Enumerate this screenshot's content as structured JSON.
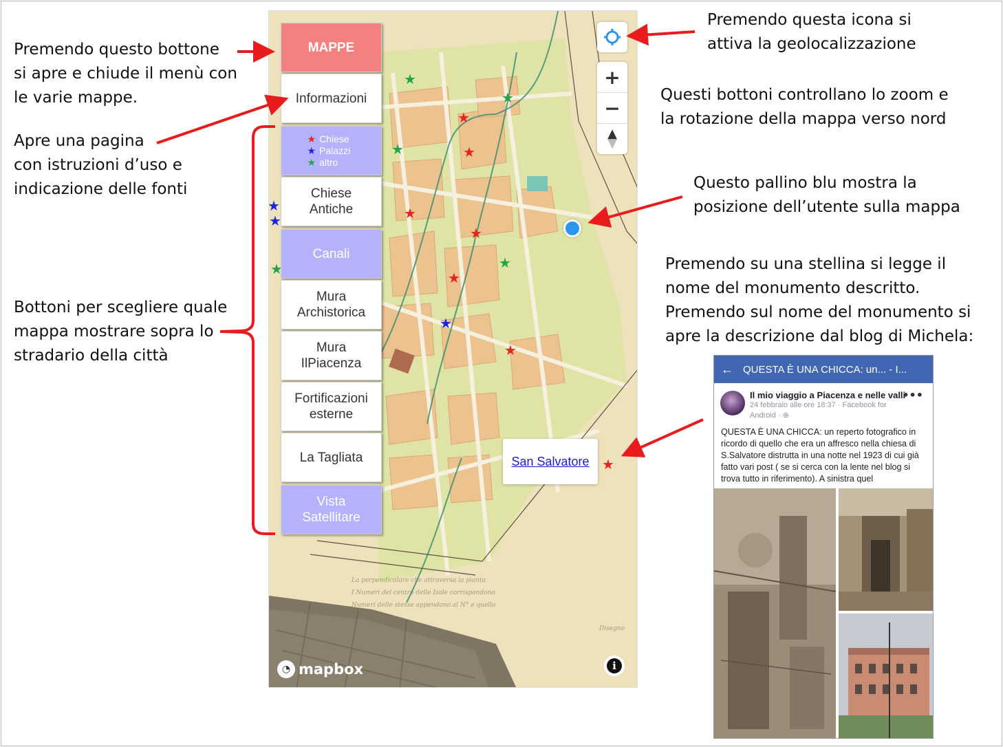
{
  "annotations": {
    "menu_toggle": [
      "Premendo questo bottone",
      "si apre e chiude il menù con",
      "le varie mappe."
    ],
    "info_page": [
      "Apre una pagina",
      "con istruzioni d’uso e",
      "indicazione delle fonti"
    ],
    "map_buttons": [
      "Bottoni per scegliere quale",
      "mappa mostrare sopra lo",
      "stradario della città"
    ],
    "geolocation": [
      "Premendo questa icona si",
      "attiva la geolocalizzazione"
    ],
    "zoom": [
      "Questi bottoni controllano lo zoom e",
      "la rotazione della mappa verso nord"
    ],
    "user_dot": [
      "Questo pallino blu mostra la",
      "posizione dell’utente sulla mappa"
    ],
    "star_click": [
      "Premendo su una stellina si legge il",
      "nome del monumento descritto.",
      "Premendo sul nome del monumento si",
      "apre la descrizione dal blog di Michela:"
    ]
  },
  "menu": {
    "toggle": "MAPPE",
    "informazioni": "Informazioni",
    "legend": [
      {
        "symbol": "★",
        "label": "Chiese",
        "color": "#e8251d"
      },
      {
        "symbol": "★",
        "label": "Palazzi",
        "color": "#1b26e2"
      },
      {
        "symbol": "★",
        "label": "altro",
        "color": "#20a548"
      }
    ],
    "chiese_1": "Chiese",
    "chiese_2": "Antiche",
    "canali": "Canali",
    "mura_a_1": "Mura",
    "mura_a_2": "Archistorica",
    "mura_p_1": "Mura",
    "mura_p_2": "IlPiacenza",
    "fort_1": "Fortificazioni",
    "fort_2": "esterne",
    "tagliata": "La Tagliata",
    "vista_1": "Vista",
    "vista_2": "Satellitare"
  },
  "map": {
    "popup_link": "San Salvatore",
    "attribution": "mapbox",
    "zoom_in": "+",
    "zoom_out": "−",
    "compass": "▲",
    "info": "i"
  },
  "facebook": {
    "header_title": "QUESTA È UNA CHICCA: un... - I...",
    "author": "Il mio viaggio a Piacenza e nelle valli",
    "meta": "24 febbraio alle ore 18:37 · Facebook for Android · ",
    "more": "•••",
    "text": "QUESTA È UNA CHICCA: un reperto fotografico in ricordo di quello che era un affresco nella chiesa di S.Salvatore distrutta in una notte nel 1923 di cui già fatto vari post ( se si cerca con la lente nel blog si trova tutto in riferimento). A sinistra quel"
  },
  "colors": {
    "primary_button": "#f48080",
    "purple_button": "#b3b2fb",
    "arrow": "#e81c1c",
    "user_dot": "#2b95f0",
    "facebook_header": "#4267b2"
  }
}
